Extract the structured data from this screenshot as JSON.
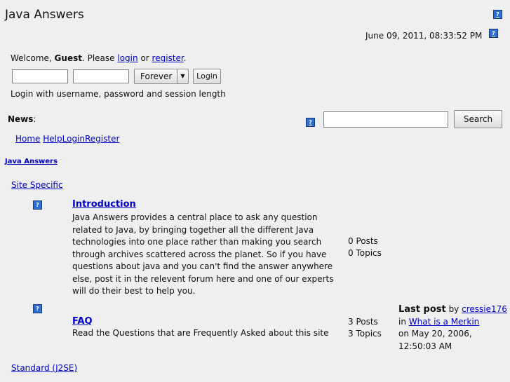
{
  "header": {
    "title": "Java Answers",
    "datetime": "June 09, 2011, 08:33:52 PM",
    "help_icon": "help-icon"
  },
  "login": {
    "welcome_prefix": "Welcome,",
    "guest": "Guest",
    "please": ". Please",
    "login_link": "login",
    "or": "or",
    "register_link": "register",
    "period": ".",
    "length_selected": "Forever",
    "login_button": "Login",
    "hint": "Login with username, password and session length"
  },
  "news": {
    "label": "News",
    "colon": ":"
  },
  "search": {
    "button": "Search"
  },
  "nav": {
    "home": "Home",
    "help": "Help",
    "login": "Login",
    "register": "Register"
  },
  "forum": {
    "title": "Java Answers",
    "category1": "Site Specific",
    "category2": "Standard (J2SE)"
  },
  "boards": [
    {
      "name": "Introduction",
      "desc_lines": [
        "Java Answers provides a central place to ask any question",
        "related to Java, by bringing together all the different Java",
        "technologies into one place rather than making you search",
        "through archives scattered across the planet. So if you have",
        "questions about java and you can't find the answer anywhere",
        "else, post it in the relevent forum here and one of our experts",
        "will do their best to help you."
      ],
      "posts": "0 Posts",
      "topics": "0 Topics"
    },
    {
      "name": "FAQ",
      "desc": "Read the Questions that are Frequently Asked about this site",
      "posts": "3 Posts",
      "topics": "3 Topics",
      "last_post_label": "Last post",
      "by": "by",
      "author": "cressie176",
      "in": "in",
      "topic": "What is a Merkin",
      "on_date": "on May 20, 2006,",
      "time": "12:50:03 AM"
    }
  ]
}
